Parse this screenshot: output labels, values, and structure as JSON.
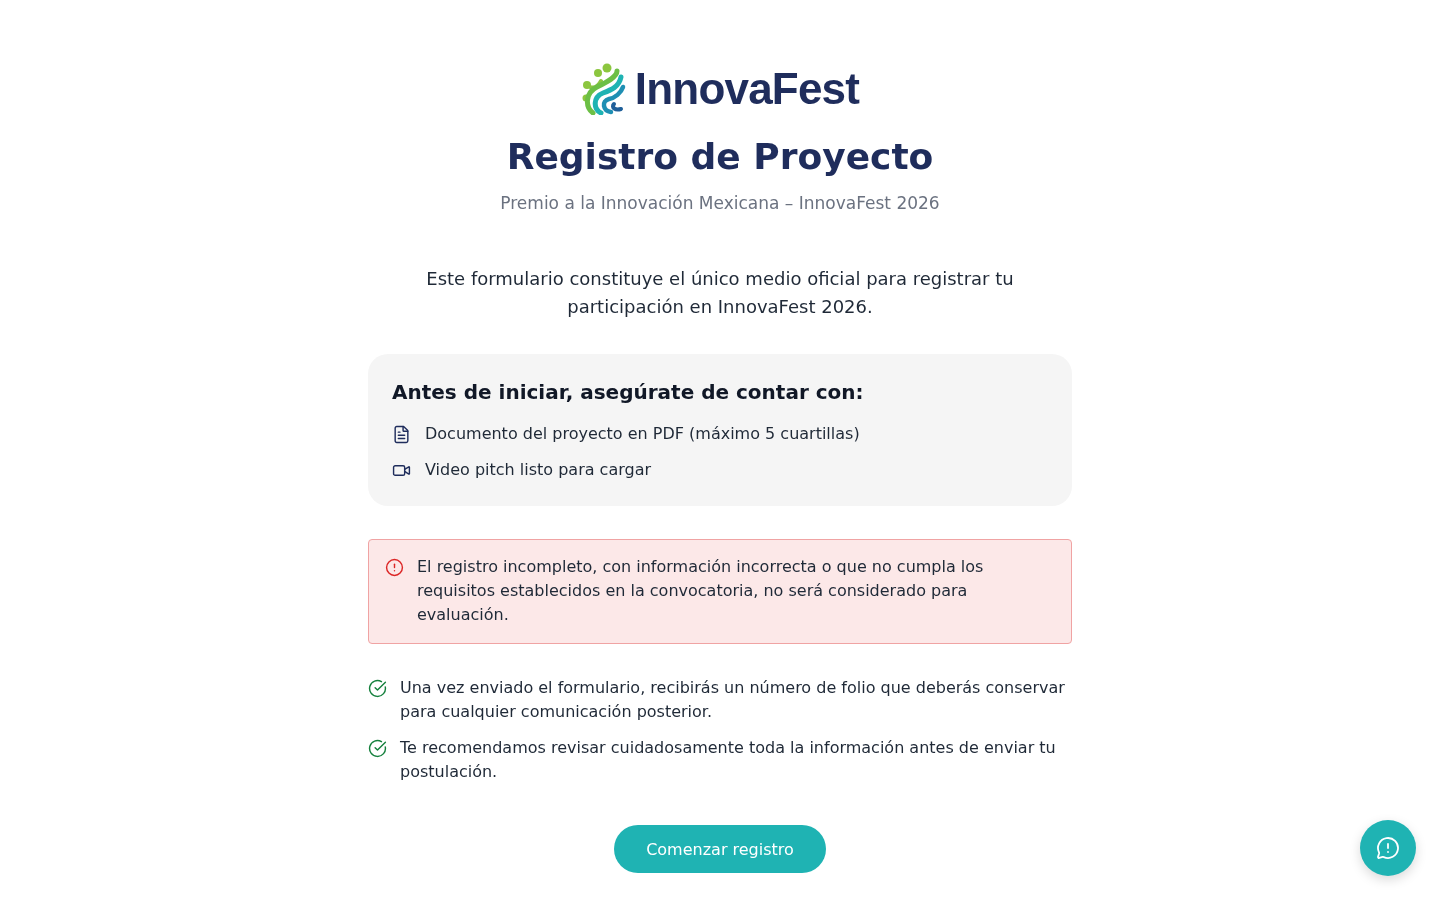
{
  "logo": {
    "wordmark": "InnovaFest"
  },
  "title": "Registro de Proyecto",
  "subtitle": "Premio a la Innovación Mexicana – InnovaFest 2026",
  "intro": "Este formulario constituye el único medio oficial para registrar tu participación en InnovaFest 2026.",
  "requirements": {
    "heading": "Antes de iniciar, asegúrate de contar con:",
    "items": [
      {
        "kind": "document",
        "label": "Documento del proyecto en PDF (máximo 5 cuartillas)"
      },
      {
        "kind": "video",
        "label": "Video pitch listo para cargar"
      }
    ]
  },
  "alert": {
    "text": "El registro incompleto, con información incorrecta o que no cumpla los requisitos establecidos en la convocatoria, no será considerado para evaluación."
  },
  "notes": [
    "Una vez enviado el formulario, recibirás un número de folio que deberás conservar para cualquier comunicación posterior.",
    "Te recomendamos revisar cuidadosamente toda la información antes de enviar tu postulación."
  ],
  "primary_button": {
    "label": "Comenzar registro"
  }
}
